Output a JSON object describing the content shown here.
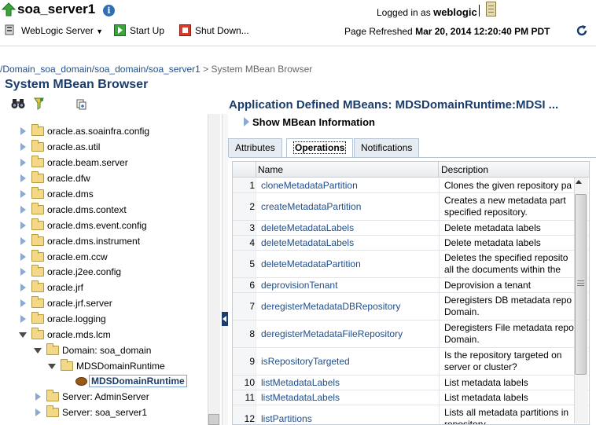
{
  "header": {
    "server_name": "soa_server1",
    "logged_in_prefix": "Logged in as",
    "logged_in_user": "weblogic",
    "weblogic_menu": "WebLogic Server",
    "start_up": "Start Up",
    "shut_down": "Shut Down...",
    "page_refreshed_label": "Page Refreshed",
    "page_refreshed_time": "Mar 20, 2014 12:20:40 PM PDT"
  },
  "breadcrumb": {
    "path": "/Domain_soa_domain/soa_domain/soa_server1",
    "separator": ">",
    "current": "System MBean Browser"
  },
  "page_title": "System MBean Browser",
  "tree": [
    {
      "label": "oracle.as.soainfra.config",
      "level": 1,
      "expanded": false
    },
    {
      "label": "oracle.as.util",
      "level": 1,
      "expanded": false
    },
    {
      "label": "oracle.beam.server",
      "level": 1,
      "expanded": false
    },
    {
      "label": "oracle.dfw",
      "level": 1,
      "expanded": false
    },
    {
      "label": "oracle.dms",
      "level": 1,
      "expanded": false
    },
    {
      "label": "oracle.dms.context",
      "level": 1,
      "expanded": false
    },
    {
      "label": "oracle.dms.event.config",
      "level": 1,
      "expanded": false
    },
    {
      "label": "oracle.dms.instrument",
      "level": 1,
      "expanded": false
    },
    {
      "label": "oracle.em.ccw",
      "level": 1,
      "expanded": false
    },
    {
      "label": "oracle.j2ee.config",
      "level": 1,
      "expanded": false
    },
    {
      "label": "oracle.jrf",
      "level": 1,
      "expanded": false
    },
    {
      "label": "oracle.jrf.server",
      "level": 1,
      "expanded": false
    },
    {
      "label": "oracle.logging",
      "level": 1,
      "expanded": false
    },
    {
      "label": "oracle.mds.lcm",
      "level": 1,
      "expanded": true
    },
    {
      "label": "Domain: soa_domain",
      "level": 2,
      "expanded": true
    },
    {
      "label": "MDSDomainRuntime",
      "level": 3,
      "expanded": true
    },
    {
      "label": "MDSDomainRuntime",
      "level": 4,
      "selected": true
    },
    {
      "label": "Server: AdminServer",
      "level": 2,
      "expanded": false
    },
    {
      "label": "Server: soa_server1",
      "level": 2,
      "expanded": false
    }
  ],
  "right": {
    "title": "Application Defined MBeans: MDSDomainRuntime:MDSI ...",
    "show_info": "Show MBean Information",
    "tabs": [
      "Attributes",
      "Operations",
      "Notifications"
    ],
    "active_tab": 1,
    "columns": [
      "Name",
      "Description"
    ]
  },
  "operations": [
    {
      "num": "1",
      "name": "cloneMetadataPartition",
      "desc": "Clones the given repository pa"
    },
    {
      "num": "2",
      "name": "createMetadataPartition",
      "desc": "Creates a new metadata part specified repository."
    },
    {
      "num": "3",
      "name": "deleteMetadataLabels",
      "desc": "Delete metadata labels"
    },
    {
      "num": "4",
      "name": "deleteMetadataLabels",
      "desc": "Delete metadata labels"
    },
    {
      "num": "5",
      "name": "deleteMetadataPartition",
      "desc": "Deletes the specified reposito all the documents within the"
    },
    {
      "num": "6",
      "name": "deprovisionTenant",
      "desc": "Deprovision a tenant"
    },
    {
      "num": "7",
      "name": "deregisterMetadataDBRepository",
      "desc": "Deregisters DB metadata repo Domain."
    },
    {
      "num": "8",
      "name": "deregisterMetadataFileRepository",
      "desc": "Deregisters File metadata repo Domain."
    },
    {
      "num": "9",
      "name": "isRepositoryTargeted",
      "desc": "Is the repository targeted on server or cluster?"
    },
    {
      "num": "10",
      "name": "listMetadataLabels",
      "desc": "List metadata labels"
    },
    {
      "num": "11",
      "name": "listMetadataLabels",
      "desc": "List metadata labels"
    },
    {
      "num": "12",
      "name": "listPartitions",
      "desc": "Lists all metadata partitions in repository."
    }
  ]
}
